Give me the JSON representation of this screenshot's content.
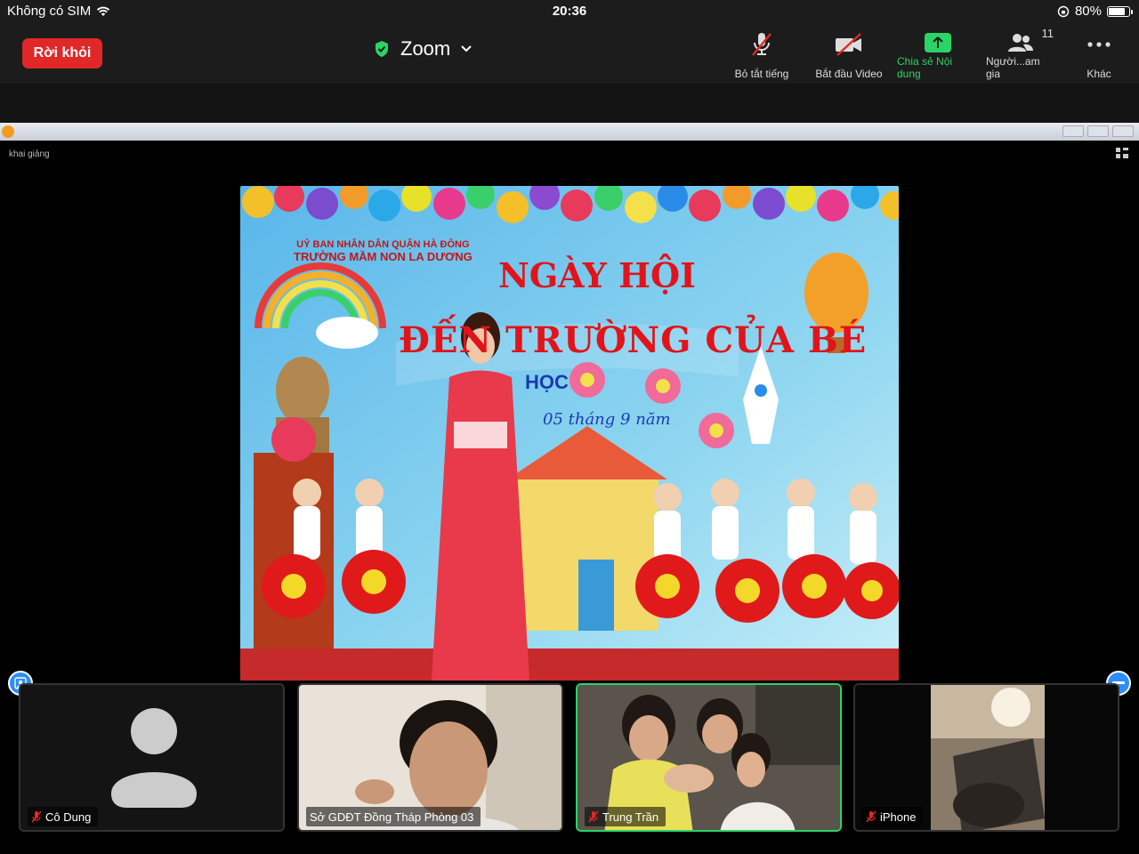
{
  "status_bar": {
    "carrier": "Không có SIM",
    "time": "20:36",
    "battery_percent": "80%",
    "battery_level": 0.8
  },
  "toolbar": {
    "leave_label": "Rời khỏi",
    "meeting_title": "Zoom",
    "tools": {
      "mute_label": "Bỏ tắt tiếng",
      "video_label": "Bắt đầu Video",
      "share_label": "Chia sẻ Nội dung",
      "participants_label": "Người...am gia",
      "participants_count": "11",
      "more_label": "Khác"
    }
  },
  "shared_screen": {
    "window_label": "khai giảng",
    "banner": {
      "org_line1": "UỶ BAN NHÂN DÂN QUẬN HÀ ĐÔNG",
      "org_line2": "TRƯỜNG MẦM NON LA DƯƠNG",
      "title_line1": "NGÀY HỘI",
      "title_line2": "ĐẾN TRƯỜNG CỦA BÉ",
      "subtitle": "HỌC",
      "date": "05 tháng 9 năm"
    }
  },
  "participants": [
    {
      "name": "Cô Dung",
      "muted": true
    },
    {
      "name": "Sở GDĐT Đồng Tháp Phòng 03",
      "muted": false
    },
    {
      "name": "Trung Trần",
      "muted": true,
      "active_speaker": true
    },
    {
      "name": "iPhone",
      "muted": true
    }
  ],
  "colors": {
    "leave": "#e02828",
    "share_green": "#2ad466",
    "toolbar_bg": "#1c1c1c",
    "accent_blue": "#2d8cff"
  }
}
